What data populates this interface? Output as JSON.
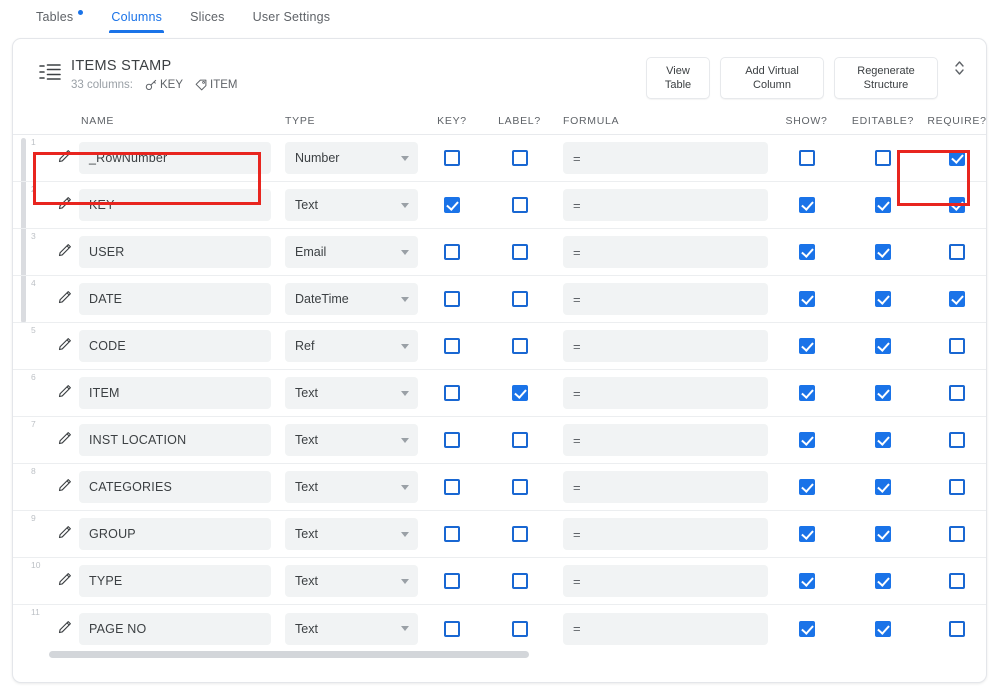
{
  "tabs": [
    {
      "label": "Tables",
      "active": false,
      "badge": true
    },
    {
      "label": "Columns",
      "active": true,
      "badge": false
    },
    {
      "label": "Slices",
      "active": false,
      "badge": false
    },
    {
      "label": "User Settings",
      "active": false,
      "badge": false
    }
  ],
  "table_header": {
    "icon": "table-list-icon",
    "title": "ITEMS STAMP",
    "columns_count_text": "33 columns:",
    "key_chip": {
      "icon": "key-icon",
      "label": "KEY"
    },
    "label_chip": {
      "icon": "tag-icon",
      "label": "ITEM"
    },
    "buttons": [
      {
        "name": "view-table-button",
        "label": "View\nTable"
      },
      {
        "name": "add-virtual-column-button",
        "label": "Add Virtual\nColumn"
      },
      {
        "name": "regenerate-structure-button",
        "label": "Regenerate\nStructure"
      }
    ],
    "expander_icon": "expand-collapse-chevrons-icon"
  },
  "column_headers": {
    "name": "NAME",
    "type": "TYPE",
    "key": "KEY?",
    "label": "LABEL?",
    "formula": "FORMULA",
    "show": "SHOW?",
    "editable": "EDITABLE?",
    "require": "REQUIRE?"
  },
  "formula_prefix": "=",
  "colors": {
    "accent": "#1a73e8",
    "checkbox_border": "#1967d2",
    "annotation": "#e8251f",
    "field_bg": "#f1f3f4",
    "text": "#3c4043",
    "muted": "#5f6368"
  },
  "rows": [
    {
      "num": "1",
      "name": "_RowNumber",
      "type": "Number",
      "key": false,
      "label": false,
      "formula": "",
      "show": false,
      "editable": false,
      "require": true
    },
    {
      "num": "2",
      "name": "KEY",
      "type": "Text",
      "key": true,
      "label": false,
      "formula": "",
      "show": true,
      "editable": true,
      "require": true
    },
    {
      "num": "3",
      "name": "USER",
      "type": "Email",
      "key": false,
      "label": false,
      "formula": "",
      "show": true,
      "editable": true,
      "require": false
    },
    {
      "num": "4",
      "name": "DATE",
      "type": "DateTime",
      "key": false,
      "label": false,
      "formula": "",
      "show": true,
      "editable": true,
      "require": true
    },
    {
      "num": "5",
      "name": "CODE",
      "type": "Ref",
      "key": false,
      "label": false,
      "formula": "",
      "show": true,
      "editable": true,
      "require": false
    },
    {
      "num": "6",
      "name": "ITEM",
      "type": "Text",
      "key": false,
      "label": true,
      "formula": "",
      "show": true,
      "editable": true,
      "require": false
    },
    {
      "num": "7",
      "name": "INST LOCATION",
      "type": "Text",
      "key": false,
      "label": false,
      "formula": "",
      "show": true,
      "editable": true,
      "require": false
    },
    {
      "num": "8",
      "name": "CATEGORIES",
      "type": "Text",
      "key": false,
      "label": false,
      "formula": "",
      "show": true,
      "editable": true,
      "require": false
    },
    {
      "num": "9",
      "name": "GROUP",
      "type": "Text",
      "key": false,
      "label": false,
      "formula": "",
      "show": true,
      "editable": true,
      "require": false
    },
    {
      "num": "10",
      "name": "TYPE",
      "type": "Text",
      "key": false,
      "label": false,
      "formula": "",
      "show": true,
      "editable": true,
      "require": false
    },
    {
      "num": "11",
      "name": "PAGE NO",
      "type": "Text",
      "key": false,
      "label": false,
      "formula": "",
      "show": true,
      "editable": true,
      "require": false
    }
  ]
}
